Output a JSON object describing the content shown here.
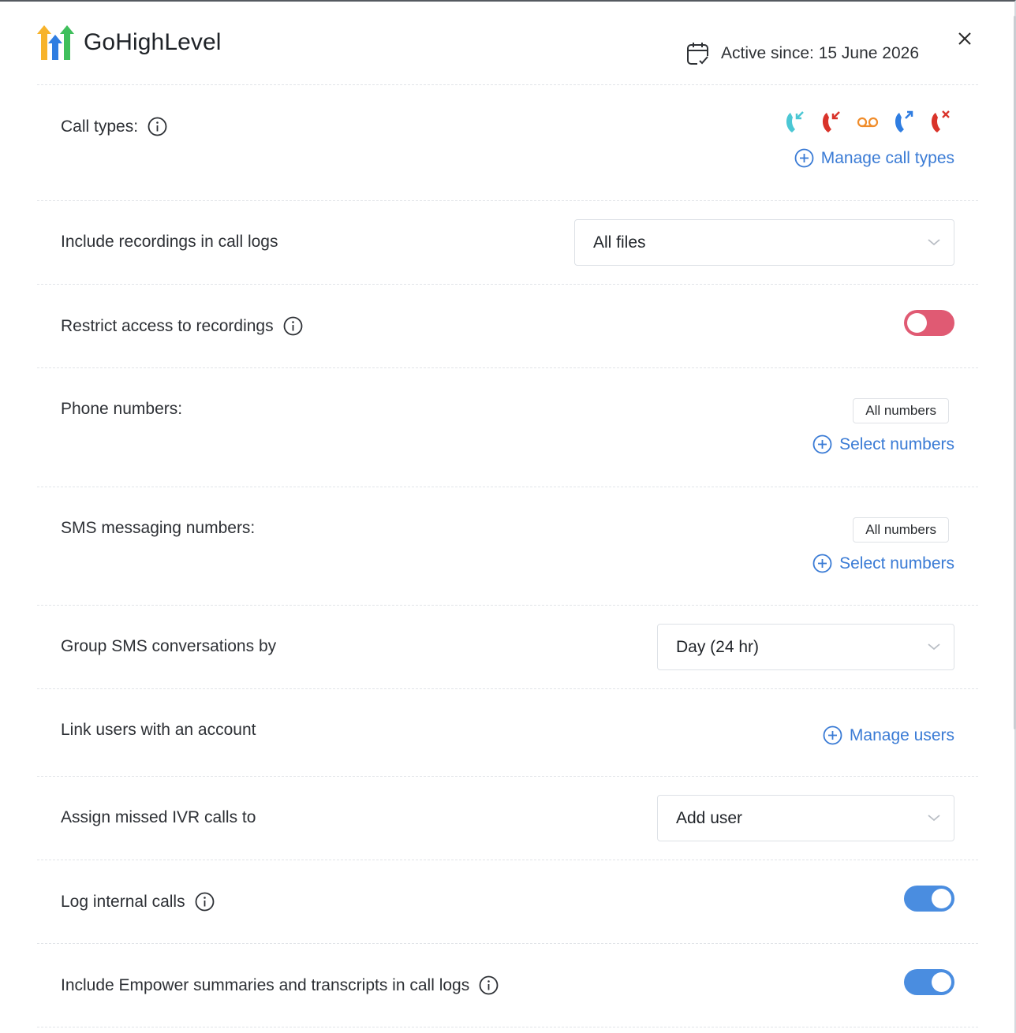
{
  "header": {
    "brand": "GoHighLevel",
    "active_since": "Active since: 15 June 2026"
  },
  "call_types": {
    "label": "Call types:",
    "icons": [
      "incoming-call-icon",
      "missed-call-icon",
      "voicemail-icon",
      "outgoing-call-icon",
      "rejected-call-icon"
    ],
    "manage_label": "Manage call types"
  },
  "recordings": {
    "label": "Include recordings in call logs",
    "value": "All files"
  },
  "restrict": {
    "label": "Restrict access to recordings",
    "enabled": false
  },
  "phone_numbers": {
    "label": "Phone numbers:",
    "pill": "All numbers",
    "select_label": "Select numbers"
  },
  "sms_numbers": {
    "label": "SMS messaging numbers:",
    "pill": "All numbers",
    "select_label": "Select numbers"
  },
  "group_sms": {
    "label": "Group SMS conversations by",
    "value": "Day (24 hr)"
  },
  "link_users": {
    "label": "Link users with an account",
    "manage_label": "Manage users"
  },
  "ivr": {
    "label": "Assign missed IVR calls to",
    "value": "Add user"
  },
  "internal_calls": {
    "label": "Log internal calls",
    "enabled": true
  },
  "empower": {
    "label": "Include Empower summaries and transcripts in call logs",
    "enabled": true
  },
  "colors": {
    "accent": "#3a7bd5",
    "toggle_on": "#4a8de0",
    "toggle_off": "#e05a73",
    "incoming": "#4bc7d4",
    "missed": "#d9332a",
    "voicemail": "#f08c2a",
    "outgoing": "#2f7de1"
  }
}
